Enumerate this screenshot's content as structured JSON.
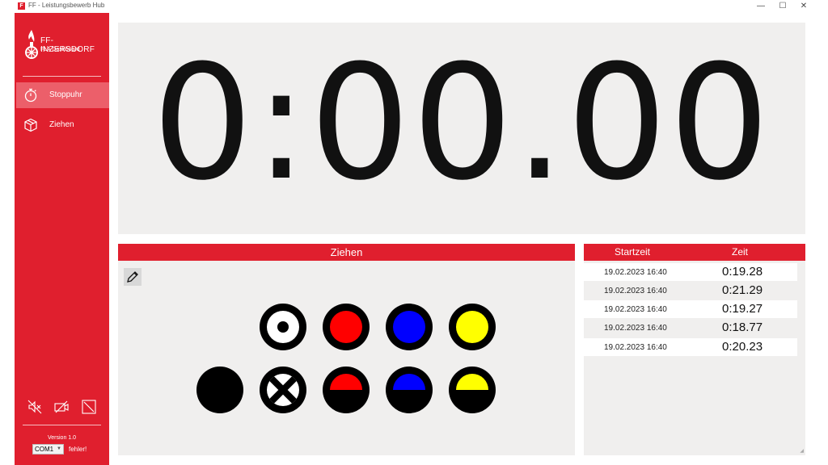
{
  "window": {
    "title": "FF - Leistungsbewerb Hub",
    "controls": {
      "minimize": "—",
      "maximize": "☐",
      "close": "✕"
    }
  },
  "brand": {
    "name": "FF-INZERSDORF",
    "subtitle": "FLA Dashboard",
    "icon": "fire-department-logo-icon"
  },
  "nav": [
    {
      "label": "Stoppuhr",
      "icon": "stopwatch-icon",
      "active": true
    },
    {
      "label": "Ziehen",
      "icon": "box-icon",
      "active": false
    }
  ],
  "sidebar_icons": [
    "sound-muted-icon",
    "camera-off-icon",
    "screen-off-icon"
  ],
  "version": "Version 1.0",
  "com": {
    "selected": "COM1",
    "status": "fehler!"
  },
  "timer": {
    "display": "0:00.00"
  },
  "pull": {
    "title": "Ziehen",
    "edit_icon": "pencil-icon",
    "top_row": [
      "target-white",
      "full-red",
      "full-blue",
      "full-yellow"
    ],
    "bottom_row": [
      "full-black",
      "cross-white",
      "half-red",
      "half-blue",
      "half-yellow"
    ],
    "colors": {
      "red": "#ff0000",
      "blue": "#0000ff",
      "yellow": "#ffff00",
      "black": "#000000",
      "white": "#ffffff"
    }
  },
  "results": {
    "headers": [
      "Startzeit",
      "Zeit"
    ],
    "rows": [
      {
        "start": "19.02.2023 16:40",
        "time": "0:19.28"
      },
      {
        "start": "19.02.2023 16:40",
        "time": "0:21.29"
      },
      {
        "start": "19.02.2023 16:40",
        "time": "0:19.27"
      },
      {
        "start": "19.02.2023 16:40",
        "time": "0:18.77"
      },
      {
        "start": "19.02.2023 16:40",
        "time": "0:20.23"
      }
    ]
  },
  "theme": {
    "accent": "#e01f2e",
    "active_nav": "#ec5f6a",
    "panel_bg": "#f0efee"
  }
}
